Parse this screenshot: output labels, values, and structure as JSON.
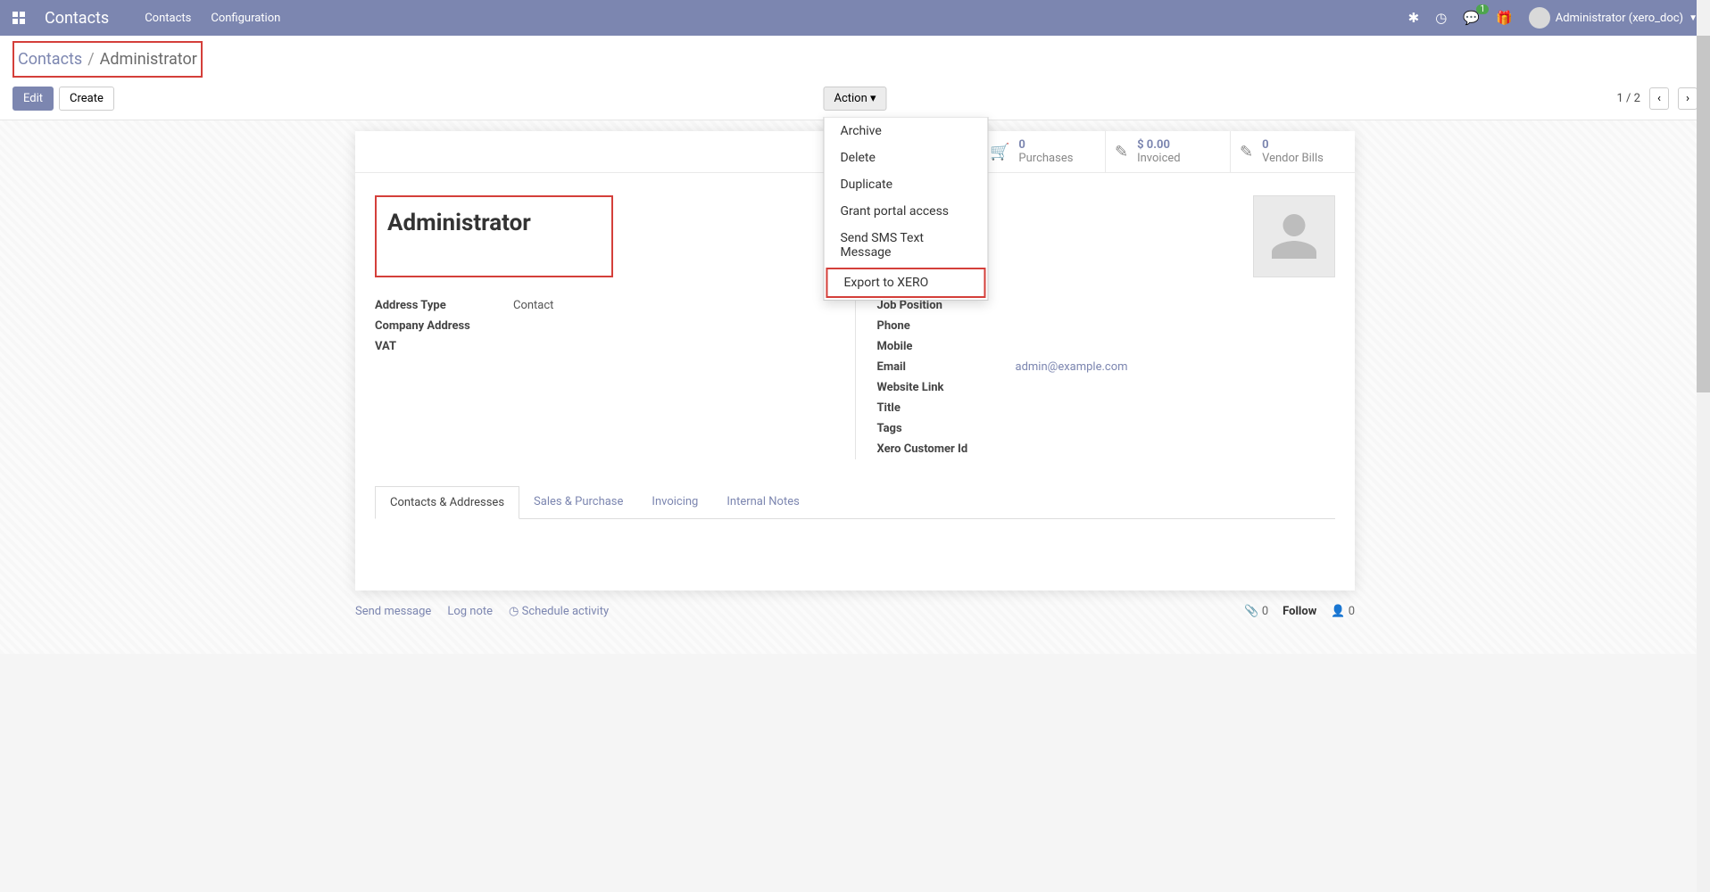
{
  "navbar": {
    "brand": "Contacts",
    "links": [
      "Contacts",
      "Configuration"
    ],
    "msg_badge": "1",
    "user_label": "Administrator (xero_doc)"
  },
  "breadcrumb": {
    "root": "Contacts",
    "current": "Administrator"
  },
  "buttons": {
    "edit": "Edit",
    "create": "Create",
    "action": "Action"
  },
  "action_menu": [
    "Archive",
    "Delete",
    "Duplicate",
    "Grant portal access",
    "Send SMS Text Message",
    "Export to XERO"
  ],
  "pager": {
    "text": "1 / 2"
  },
  "stats": [
    {
      "value": "0",
      "label": "Purchases"
    },
    {
      "value": "$ 0.00",
      "label": "Invoiced"
    },
    {
      "value": "0",
      "label": "Vendor Bills"
    }
  ],
  "record": {
    "name": "Administrator"
  },
  "fields_left": [
    {
      "label": "Address Type",
      "value": "Contact"
    },
    {
      "label": "Company Address",
      "value": ""
    },
    {
      "label": "VAT",
      "value": ""
    }
  ],
  "fields_right": [
    {
      "label": "Job Position",
      "value": ""
    },
    {
      "label": "Phone",
      "value": ""
    },
    {
      "label": "Mobile",
      "value": ""
    },
    {
      "label": "Email",
      "value": "admin@example.com",
      "link": true
    },
    {
      "label": "Website Link",
      "value": ""
    },
    {
      "label": "Title",
      "value": ""
    },
    {
      "label": "Tags",
      "value": ""
    },
    {
      "label": "Xero Customer Id",
      "value": ""
    }
  ],
  "tabs": [
    "Contacts & Addresses",
    "Sales & Purchase",
    "Invoicing",
    "Internal Notes"
  ],
  "footer": {
    "send": "Send message",
    "log": "Log note",
    "schedule": "Schedule activity",
    "attach_count": "0",
    "follow": "Follow",
    "follower_count": "0"
  }
}
